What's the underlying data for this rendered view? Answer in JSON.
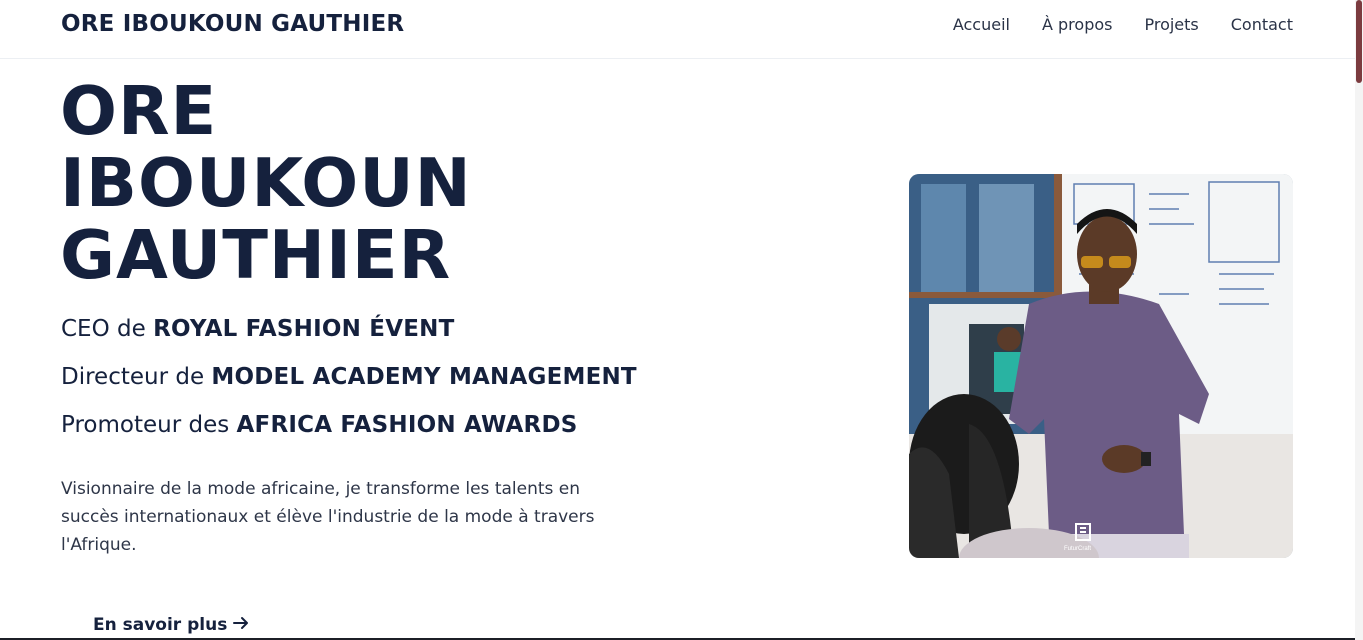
{
  "nav": {
    "brand": "ORE IBOUKOUN GAUTHIER",
    "links": [
      "Accueil",
      "À propos",
      "Projets",
      "Contact"
    ]
  },
  "hero": {
    "name_lines": [
      "ORE",
      "IBOUKOUN",
      "GAUTHIER"
    ],
    "roles": [
      {
        "prefix": "CEO de ",
        "org": "ROYAL FASHION ÉVENT"
      },
      {
        "prefix": "Directeur de ",
        "org": "MODEL ACADEMY MANAGEMENT"
      },
      {
        "prefix": "Promoteur des ",
        "org": "AFRICA FASHION AWARDS"
      }
    ],
    "bio": "Visionnaire de la mode africaine, je transforme les talents en succès internationaux et élève l'industrie de la mode à travers l'Afrique.",
    "cta_label": "En savoir plus",
    "cta_icon": "arrow-right-icon",
    "photo_watermark": "FuturCraft"
  },
  "colors": {
    "text_primary": "#15213d",
    "text_secondary": "#2e3648",
    "scrollbar_thumb": "#7b3b3f"
  }
}
